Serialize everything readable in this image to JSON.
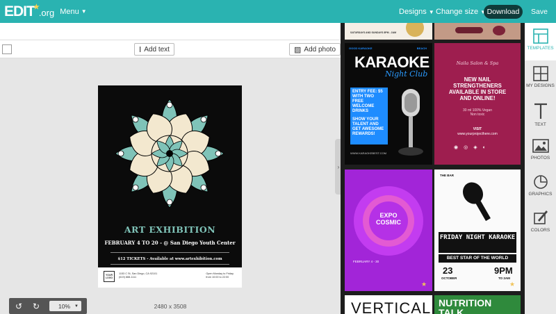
{
  "topbar": {
    "logo_text": "EDIT",
    "logo_suffix": ".org",
    "menu_label": "Menu",
    "designs_label": "Designs",
    "change_size_label": "Change size",
    "download_label": "Download",
    "save_label": "Save"
  },
  "toolbar": {
    "add_text_label": "Add text",
    "add_photo_label": "Add photo"
  },
  "poster": {
    "title": "ART EXHIBITION",
    "subtitle": "FEBRUARY 4 TO 20 - @ San Diego Youth Center",
    "ticket_line": "$12 TICKETS - Available at www.artexhibition.com",
    "logo_text": "YOUR LOGO",
    "address_line1": "1153 C St, San Diego, CA 92101",
    "address_line2": "(619) 888-1111",
    "hours_line1": "Open Monday to Friday",
    "hours_line2": "from 10:00 to 22:00"
  },
  "canvas": {
    "dimensions": "2480 x 3508",
    "zoom": "10%"
  },
  "templates": {
    "karaoke": {
      "title": "KARAOKE",
      "script": "Night Club",
      "top_left": "GOOD KARAOKE",
      "top_right": "BEACH",
      "promo": "ENTRY FEE: $5 WITH TWO FREE WELCOME DRINKS",
      "promo2": "SHOW YOUR TALENT AND GET AWESOME REWARDS!",
      "url": "WWW.KARAOKEBEST.COM"
    },
    "nails": {
      "script": "Naila Salon & Spa",
      "headline": "NEW NAIL STRENGTHENERS AVAILABLE IN STORE AND ONLINE!",
      "details": "30 ml 100% Vegan Non toxic",
      "visit": "VISIT",
      "url": "www.yourprojecthere.com"
    },
    "expo": {
      "title": "EXPO COSMIC",
      "date": "FEBRUARY 4 - 30"
    },
    "friday": {
      "bar": "THE BAR",
      "title": "FRIDAY NIGHT KARAOKE",
      "tagline": "BEST STAR OF THE WORLD",
      "day": "23",
      "month": "OCTOBER",
      "time": "9PM",
      "time_sub": "TO 2AM"
    },
    "vertical": {
      "title": "VERTICAL"
    },
    "nutrition": {
      "title": "NUTRITION TALK"
    },
    "top_banner": {
      "text": "SATURDAYS AND SUNDAYS 8PM - 2AM"
    }
  },
  "sidebar": {
    "items": [
      {
        "label": "TEMPLATES",
        "icon": "templates-icon"
      },
      {
        "label": "MY DESIGNS",
        "icon": "my-designs-icon"
      },
      {
        "label": "TEXT",
        "icon": "text-icon"
      },
      {
        "label": "PHOTOS",
        "icon": "photos-icon"
      },
      {
        "label": "GRAPHICS",
        "icon": "graphics-icon"
      },
      {
        "label": "COLORS",
        "icon": "colors-icon"
      }
    ]
  },
  "colors": {
    "brand": "#2ab3b1",
    "download_bg": "#0f3b3a",
    "poster_title": "#7fc3b8"
  }
}
